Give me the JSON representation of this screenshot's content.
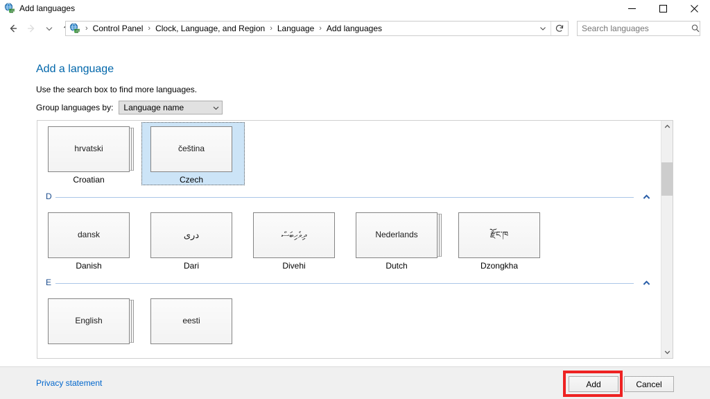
{
  "window": {
    "title": "Add languages",
    "icon": "language-globe-icon",
    "controls": {
      "minimize": "minimize-icon",
      "maximize": "maximize-icon",
      "close": "close-icon"
    }
  },
  "nav": {
    "back": "back-arrow-icon",
    "forward": "forward-arrow-icon",
    "recent": "recent-locations-chevron-icon",
    "up": "up-arrow-icon",
    "address_icon": "control-panel-globe-icon",
    "breadcrumbs": [
      "Control Panel",
      "Clock, Language, and Region",
      "Language",
      "Add languages"
    ],
    "separator": "›",
    "dropdown_icon": "chevron-down-icon",
    "refresh_icon": "refresh-icon"
  },
  "search": {
    "placeholder": "Search languages",
    "value": "",
    "icon": "search-icon"
  },
  "main": {
    "page_title": "Add a language",
    "instruction": "Use the search box to find more languages.",
    "group_by_label": "Group languages by:",
    "group_by_value": "Language name",
    "group_by_arrow": "chevron-down-icon"
  },
  "list": {
    "scroll_up_icon": "scroll-up-arrow-icon",
    "scroll_down_icon": "scroll-down-arrow-icon",
    "collapse_icon": "collapse-chevron-icon",
    "sections": [
      {
        "letter": "",
        "show_header": false,
        "languages": [
          {
            "native": "hrvatski",
            "english": "Croatian",
            "selected": false,
            "stacked": true,
            "rtl": false
          },
          {
            "native": "čeština",
            "english": "Czech",
            "selected": true,
            "stacked": false,
            "rtl": false
          }
        ]
      },
      {
        "letter": "D",
        "show_header": true,
        "languages": [
          {
            "native": "dansk",
            "english": "Danish",
            "selected": false,
            "stacked": false,
            "rtl": false
          },
          {
            "native": "دری",
            "english": "Dari",
            "selected": false,
            "stacked": false,
            "rtl": true
          },
          {
            "native": "ދިވެހިބަސް",
            "english": "Divehi",
            "selected": false,
            "stacked": false,
            "rtl": true
          },
          {
            "native": "Nederlands",
            "english": "Dutch",
            "selected": false,
            "stacked": true,
            "rtl": false
          },
          {
            "native": "རྫོང་ཁ",
            "english": "Dzongkha",
            "selected": false,
            "stacked": false,
            "rtl": false
          }
        ]
      },
      {
        "letter": "E",
        "show_header": true,
        "languages": [
          {
            "native": "English",
            "english": "",
            "selected": false,
            "stacked": true,
            "rtl": false
          },
          {
            "native": "eesti",
            "english": "",
            "selected": false,
            "stacked": false,
            "rtl": false
          }
        ]
      }
    ]
  },
  "footer": {
    "privacy_link": "Privacy statement",
    "add_label": "Add",
    "cancel_label": "Cancel"
  },
  "annotation": {
    "target": "add-button",
    "color": "#ee2222"
  }
}
